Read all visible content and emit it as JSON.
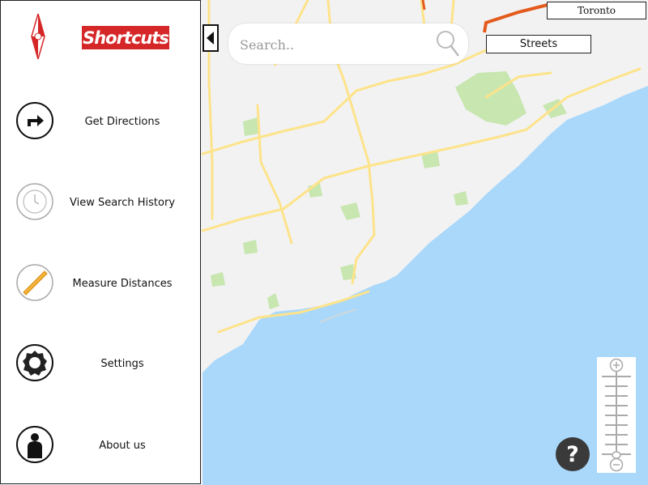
{
  "app": {
    "logo_text": "Shortcuts",
    "logo_icon": "compass-icon"
  },
  "menu": {
    "items": [
      {
        "label": "Get Directions",
        "icon": "turn-right-arrow-icon"
      },
      {
        "label": "View Search History",
        "icon": "clock-icon"
      },
      {
        "label": "Measure Distances",
        "icon": "ruler-icon"
      },
      {
        "label": "Settings",
        "icon": "gear-icon"
      },
      {
        "label": "About us",
        "icon": "person-icon"
      }
    ]
  },
  "search": {
    "placeholder": "Search..",
    "value": ""
  },
  "map": {
    "location_label": "Toronto",
    "layer_button": "Streets",
    "help_label": "?",
    "colors": {
      "land": "#f2f2f2",
      "water": "#a9d8fb",
      "park": "#c8e6b0",
      "road": "#fde38a",
      "highway": "#e45a1c"
    }
  },
  "colors": {
    "brand_red": "#d62728",
    "panel_border": "#222222"
  }
}
